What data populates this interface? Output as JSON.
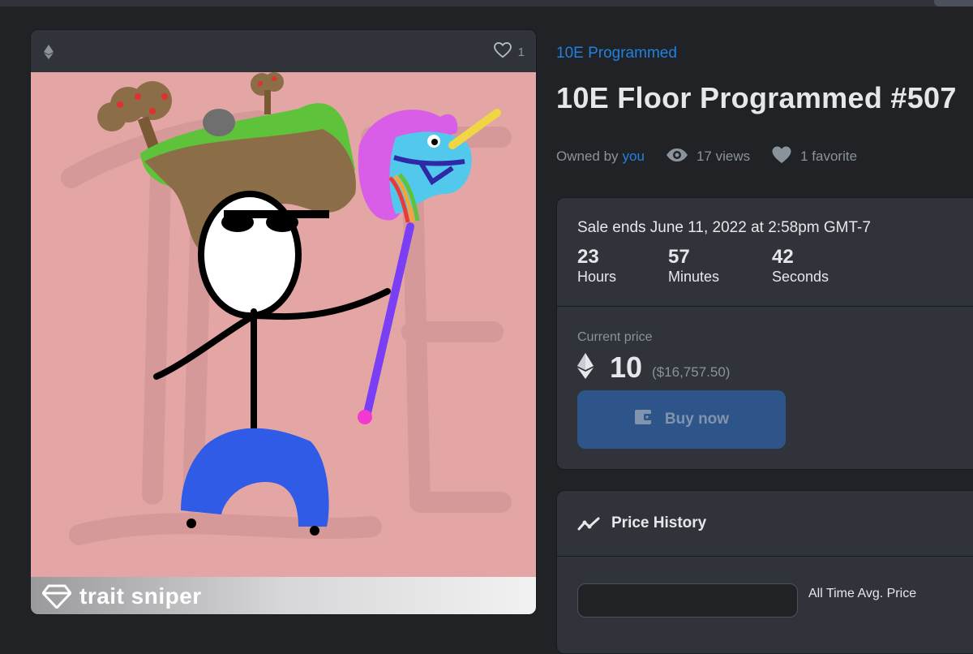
{
  "card": {
    "favorite_count": "1",
    "banner_text": "trait sniper"
  },
  "asset": {
    "collection": "10E Programmed",
    "title": "10E Floor Programmed #507",
    "owned_by_label": "Owned by",
    "owner": "you",
    "views": "17 views",
    "favorites": "1 favorite"
  },
  "sale": {
    "ends": "Sale ends June 11, 2022 at 2:58pm GMT-7",
    "countdown": [
      {
        "value": "23",
        "label": "Hours"
      },
      {
        "value": "57",
        "label": "Minutes"
      },
      {
        "value": "42",
        "label": "Seconds"
      }
    ],
    "current_price_label": "Current price",
    "price": "10",
    "price_usd": "($16,757.50)",
    "buy_label": "Buy now"
  },
  "history": {
    "title": "Price History",
    "avg_label": "All Time Avg. Price"
  },
  "colors": {
    "link": "#2081e2",
    "background": "#202225",
    "panel": "#303339",
    "buy_button": "#2e5589"
  }
}
